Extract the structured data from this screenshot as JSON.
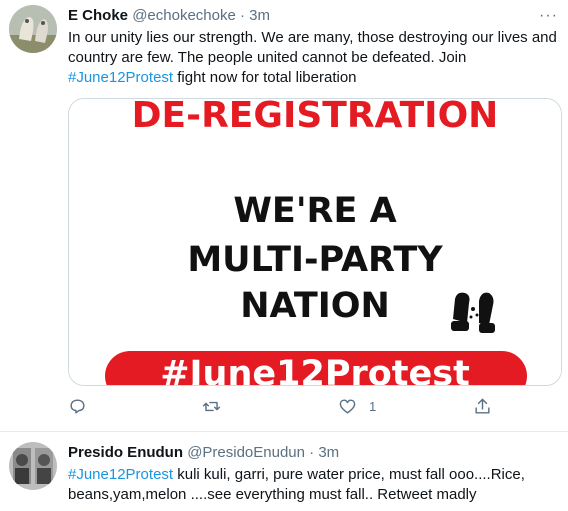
{
  "tweets": [
    {
      "name": "E Choke",
      "handle": "@echokechoke",
      "time": "3m",
      "text_before": "In our unity lies our strength. We are many, those destroying our lives and country are few. The people united cannot be defeated. Join",
      "hashtag": "#June12Protest",
      "text_after": "fight now for total liberation",
      "media": {
        "line1": "DE-REGISTRATION",
        "line2": "WE'RE A",
        "line3": "MULTI-PARTY",
        "line4": "NATION",
        "banner": "#June12Protest"
      },
      "likes": "1"
    },
    {
      "name": "Presido Enudun",
      "handle": "@PresidoEnudun",
      "time": "3m",
      "hashtag": "#June12Protest",
      "text_after": "kuli kuli, garri, pure water price, must fall ooo....Rice, beans,yam,melon ....see everything must fall.. Retweet madly"
    }
  ],
  "colors": {
    "accent": "#1b95e0",
    "red": "#e41b22",
    "muted": "#5b7083"
  },
  "icons": [
    "reply-icon",
    "retweet-icon",
    "like-icon",
    "share-icon",
    "more-icon",
    "fist-icon"
  ]
}
